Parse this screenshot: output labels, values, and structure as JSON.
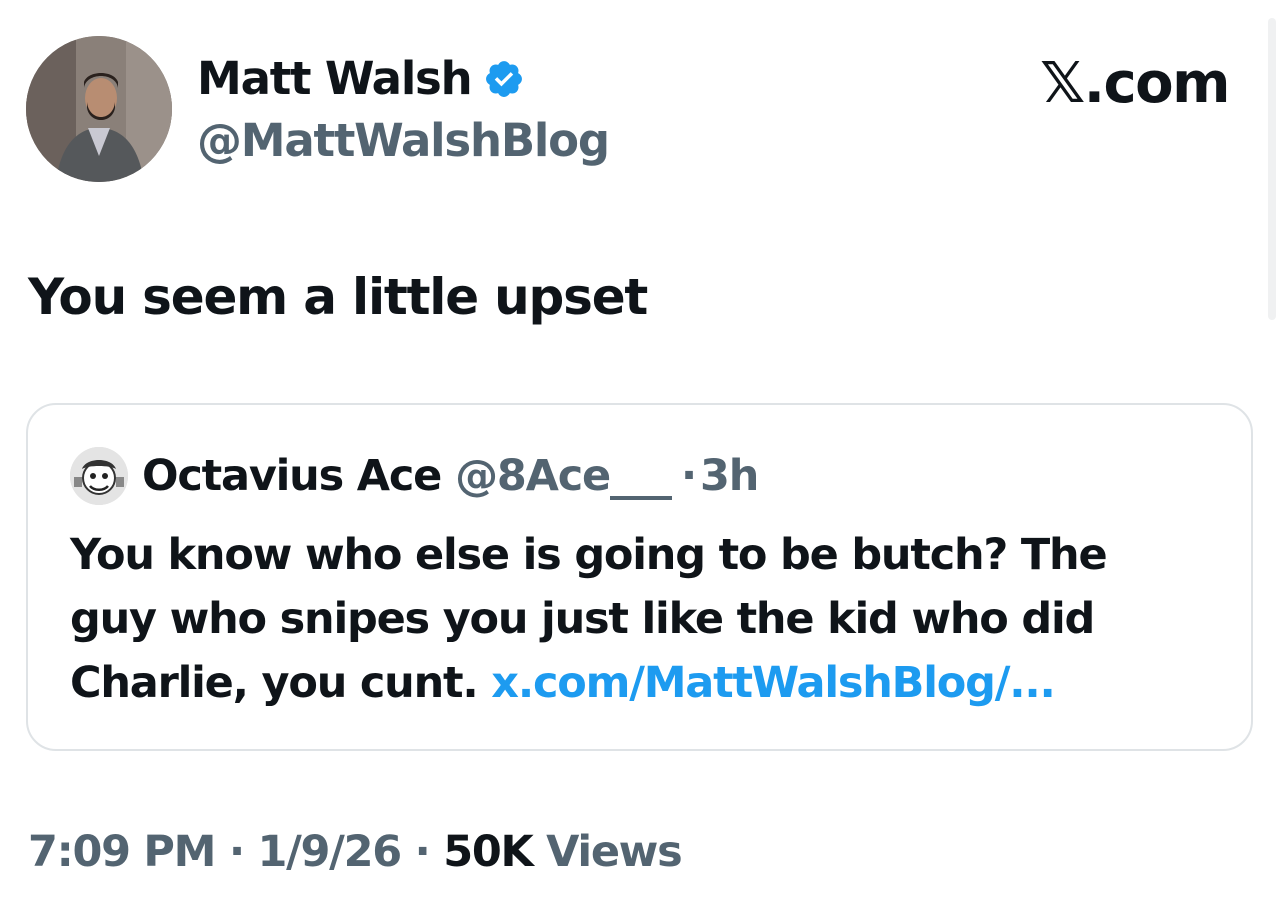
{
  "author": {
    "display_name": "Matt Walsh",
    "handle": "@MattWalshBlog",
    "verified": true,
    "avatar_icon": "profile-photo"
  },
  "brand": {
    "logo_text": "𝕏.com"
  },
  "tweet": {
    "text": "You seem a little upset"
  },
  "quoted_tweet": {
    "author_name": "Octavius Ace",
    "author_handle": "@8Ace___",
    "separator": "·",
    "age": "3h",
    "avatar_icon": "cartoon-avatar",
    "lines": [
      "You know who else is going to be butch? The",
      "guy who snipes you just like the kid who did",
      "Charlie, you cunt."
    ],
    "link_text": "x.com/MattWalshBlog/..."
  },
  "meta": {
    "time": "7:09 PM",
    "date": "1/9/26",
    "separator": "·",
    "views_count": "50K",
    "views_label": "Views"
  },
  "colors": {
    "text_primary": "#0f1419",
    "text_secondary": "#536471",
    "link": "#1d9bf0",
    "verified_badge": "#1d9bf0",
    "card_border": "#dfe3e6"
  }
}
